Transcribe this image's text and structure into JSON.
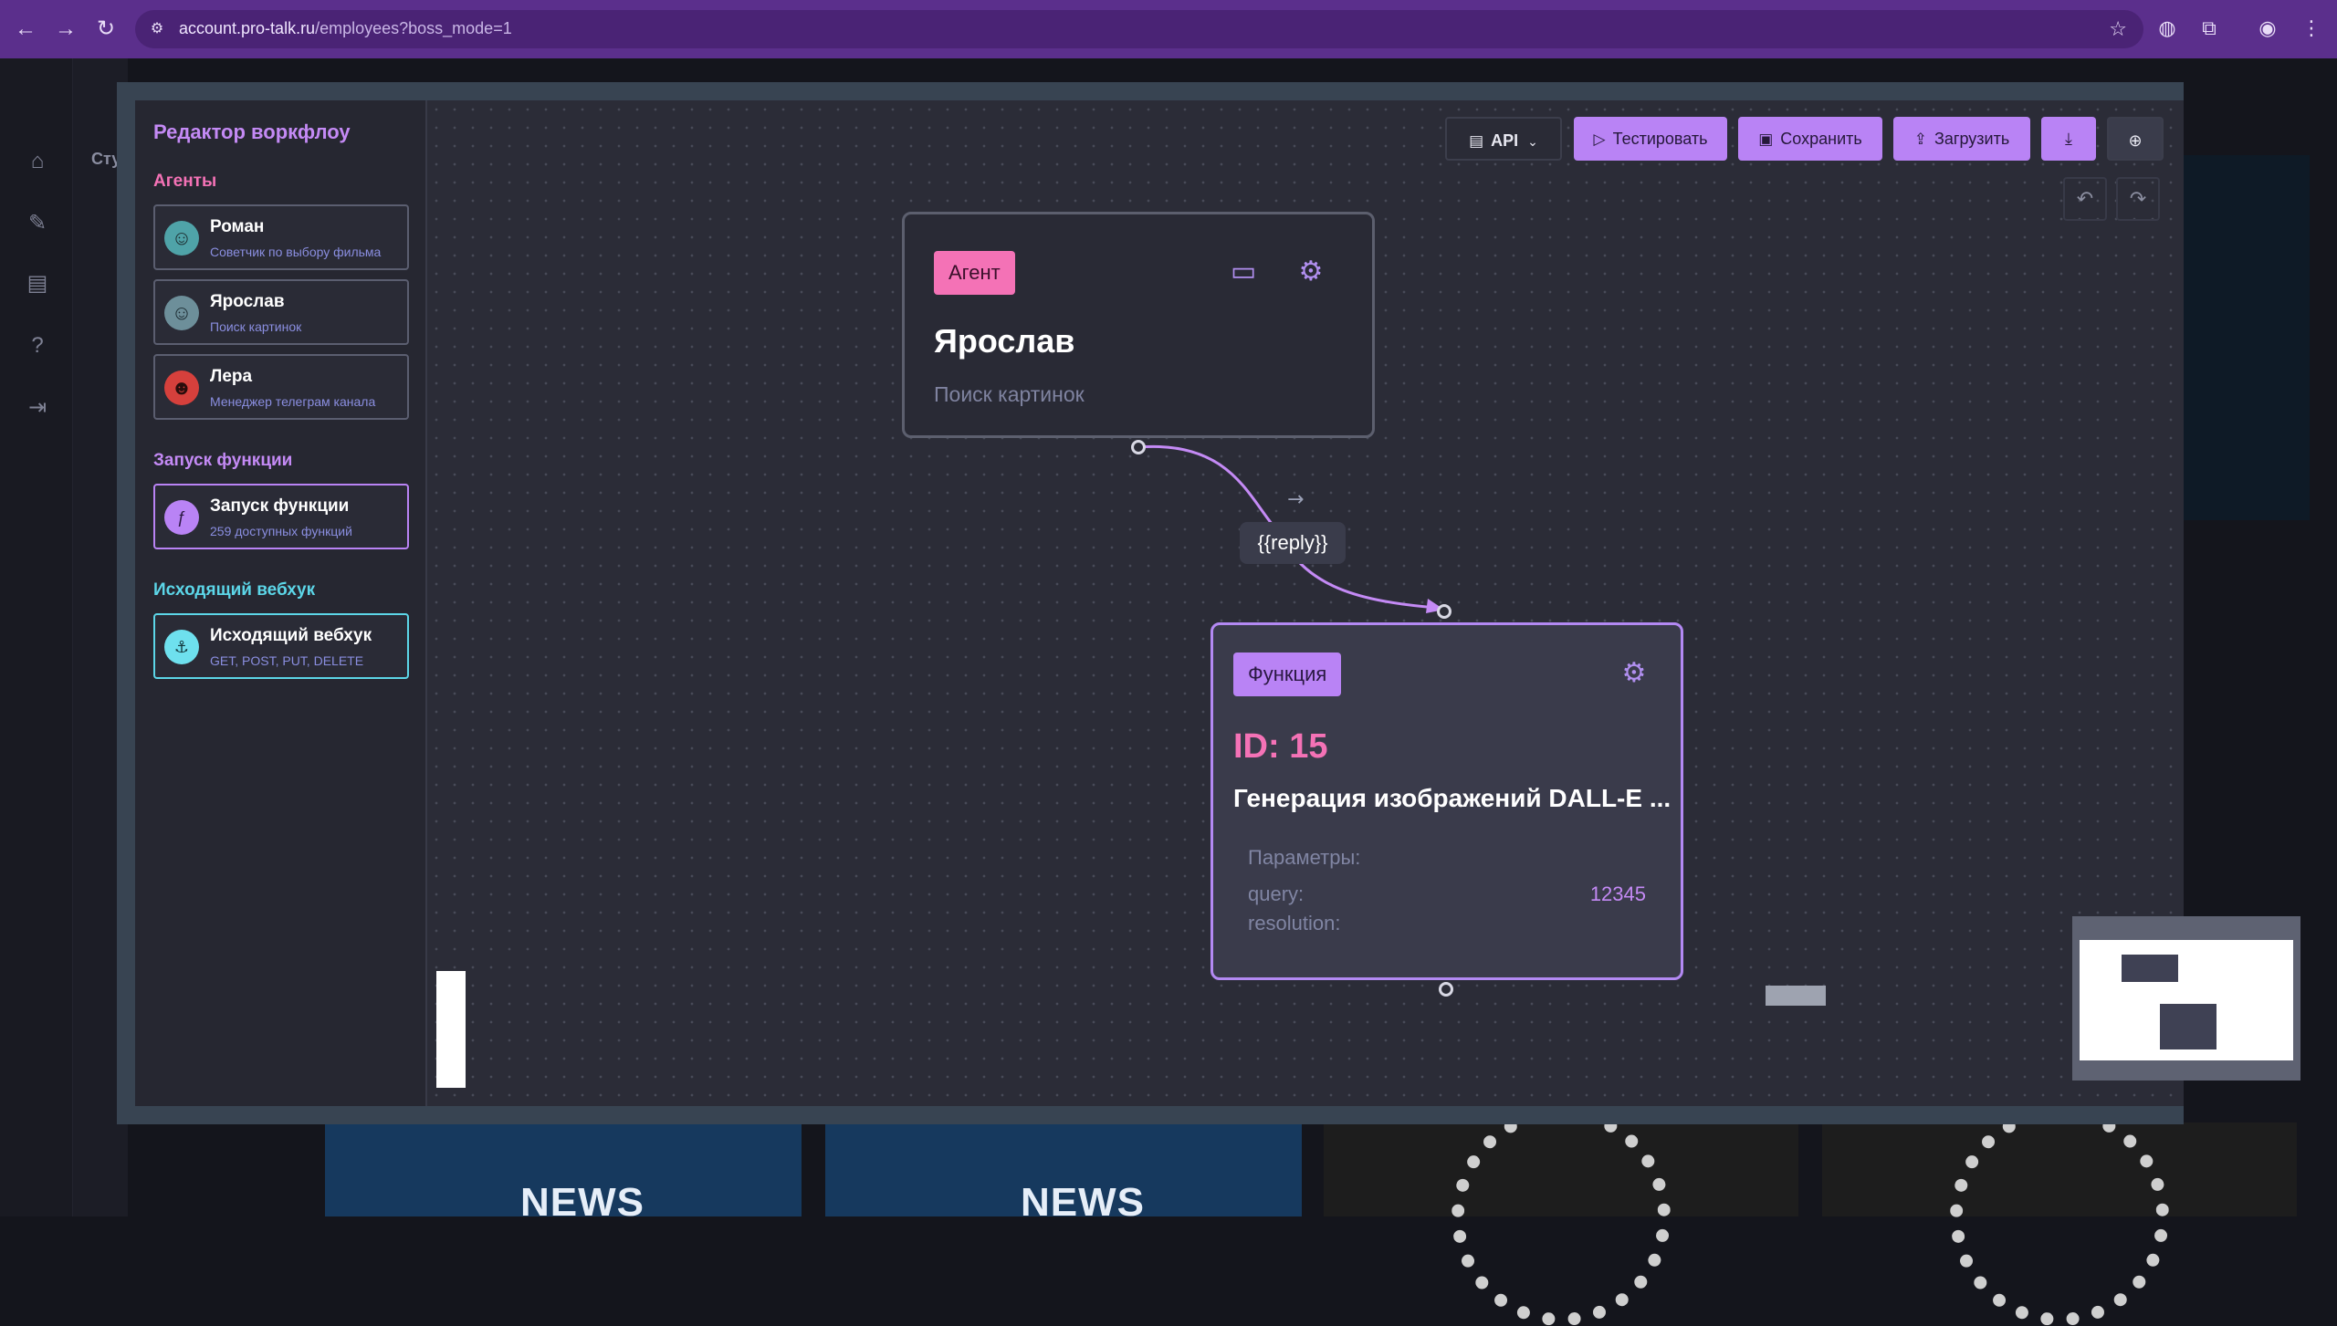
{
  "browser": {
    "url_host": "account.pro-talk.ru",
    "url_path": "/employees?boss_mode=1"
  },
  "background": {
    "sidebar_label": "Сту",
    "news_word": "NEWS"
  },
  "editor": {
    "title": "Редактор воркфлоу",
    "sections": {
      "agents": "Агенты",
      "functions": "Запуск функции",
      "webhooks": "Исходящий вебхук"
    },
    "agents": [
      {
        "name": "Роман",
        "desc": "Советчик по выбору фильма"
      },
      {
        "name": "Ярослав",
        "desc": "Поиск картинок"
      },
      {
        "name": "Лера",
        "desc": "Менеджер телеграм канала"
      }
    ],
    "function_card": {
      "name": "Запуск функции",
      "desc": "259 доступных функций"
    },
    "webhook_card": {
      "name": "Исходящий вебхук",
      "desc": "GET, POST, PUT, DELETE"
    },
    "section_colors": {
      "agents": "#f472b6",
      "functions": "#c48af5",
      "webhooks": "#5cd6e8"
    }
  },
  "toolbar": {
    "api_label": "API",
    "test_label": "Тестировать",
    "save_label": "Сохранить",
    "upload_label": "Загрузить"
  },
  "agent_node": {
    "tag": "Агент",
    "title": "Ярослав",
    "subtitle": "Поиск картинок"
  },
  "edge": {
    "label": "{{reply}}"
  },
  "function_node": {
    "tag": "Функция",
    "id": "ID: 15",
    "name": "Генерация изображений DALL-E ...",
    "params_label": "Параметры:",
    "param_query": "query:",
    "param_resolution": "resolution:",
    "query_value": "12345"
  },
  "colors": {
    "accent_purple": "#b983f5",
    "accent_pink": "#f472b6",
    "browser_bar": "#5b2f8c"
  }
}
